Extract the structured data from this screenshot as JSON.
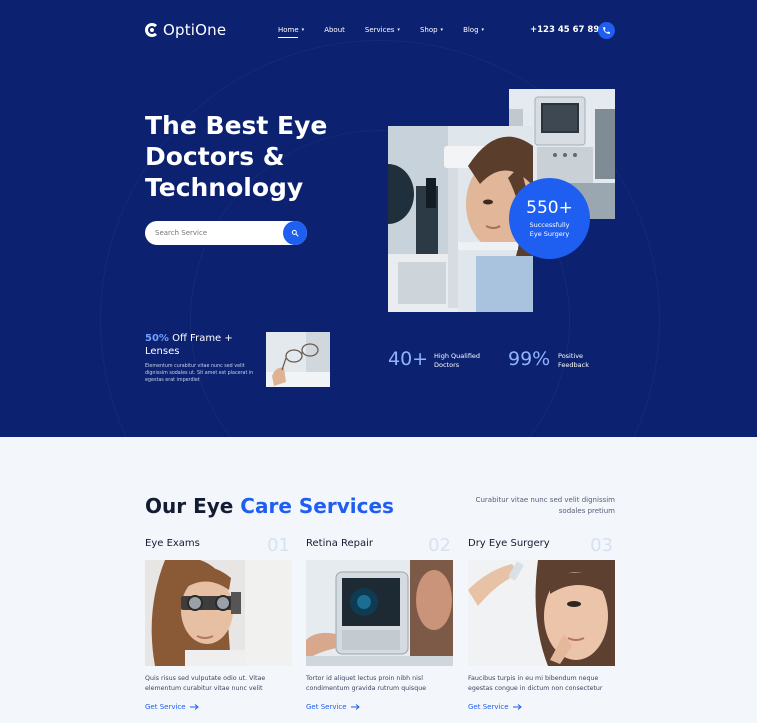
{
  "brand": {
    "name": "OptiOne"
  },
  "nav": {
    "items": [
      {
        "label": "Home",
        "has_caret": true
      },
      {
        "label": "About",
        "has_caret": false
      },
      {
        "label": "Services",
        "has_caret": true
      },
      {
        "label": "Shop",
        "has_caret": true
      },
      {
        "label": "Blog",
        "has_caret": true
      }
    ],
    "caret": "▾",
    "phone": "+123 45 67 890"
  },
  "hero": {
    "title": "The Best Eye Doctors & Technology",
    "search_placeholder": "Search Service",
    "badge": {
      "value": "550+",
      "label": "Successfully Eye Surgery"
    },
    "promo": {
      "highlight": "50%",
      "title": " Off Frame + Lenses",
      "text": "Elementum curabitur vitae nunc sed velit dignissim sodales ut. Sit amet est placerat in egestas erat imperdiet"
    },
    "kpis": [
      {
        "value": "40+",
        "label": "High Qualified Doctors"
      },
      {
        "value": "99%",
        "label": "Positive Feedback"
      }
    ]
  },
  "services": {
    "title_plain": "Our Eye ",
    "title_highlight": "Care Services",
    "subtitle": "Curabitur vitae nunc sed velit dignissim sodales pretium",
    "cards": [
      {
        "title": "Eye Exams",
        "num": "01",
        "text": "Quis risus sed vulputate odio ut. Vitae elementum curabitur vitae nunc velit",
        "link": "Get Service"
      },
      {
        "title": "Retina Repair",
        "num": "02",
        "text": "Tortor id aliquet lectus proin nibh nisl condimentum gravida rutrum quisque",
        "link": "Get Service"
      },
      {
        "title": "Dry Eye Surgery",
        "num": "03",
        "text": "Faucibus turpis in eu mi bibendum neque egestas congue in dictum non consectetur",
        "link": "Get Service"
      }
    ]
  },
  "colors": {
    "navy": "#0c2270",
    "accent": "#1e5ef0",
    "light_bg": "#f3f6fa"
  }
}
